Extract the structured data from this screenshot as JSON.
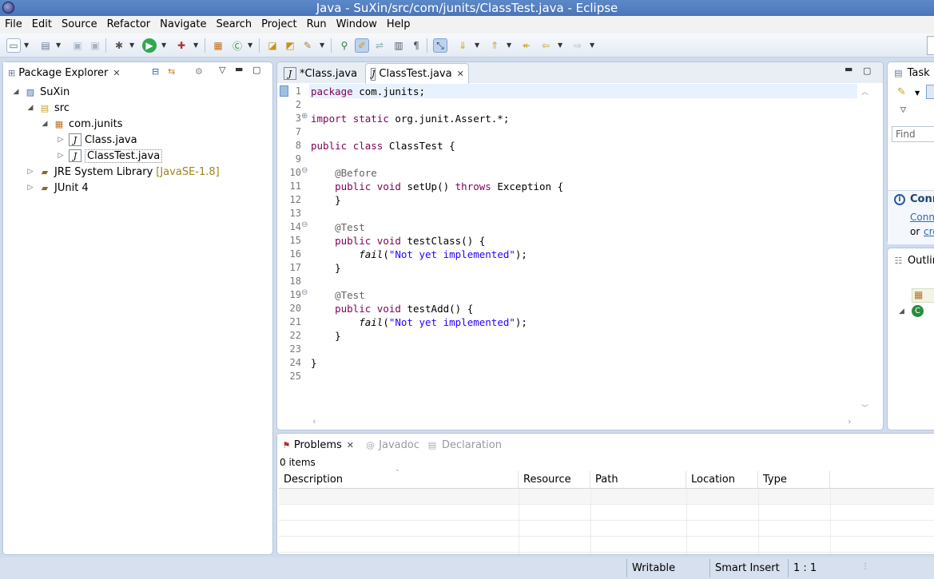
{
  "window": {
    "title": "Java - SuXin/src/com/junits/ClassTest.java - Eclipse"
  },
  "menu": [
    "File",
    "Edit",
    "Source",
    "Refactor",
    "Navigate",
    "Search",
    "Project",
    "Run",
    "Window",
    "Help"
  ],
  "package_explorer": {
    "title": "Package Explorer",
    "tree": {
      "project": "SuXin",
      "src": "src",
      "package": "com.junits",
      "file1": "Class.java",
      "file2": "ClassTest.java",
      "jre": "JRE System Library",
      "jre_version": "[JavaSE-1.8]",
      "junit": "JUnit 4"
    }
  },
  "editor": {
    "tabs": [
      "*Class.java",
      "ClassTest.java"
    ],
    "active_tab": 1,
    "line_numbers": [
      "1",
      "2",
      "3",
      "7",
      "8",
      "9",
      "10",
      "11",
      "12",
      "13",
      "14",
      "15",
      "16",
      "17",
      "18",
      "19",
      "20",
      "21",
      "22",
      "23",
      "24",
      "25"
    ]
  },
  "right_panel": {
    "task_title": "Task L",
    "find_placeholder": "Find",
    "connect_title": "Conn",
    "connect_link": "Conn",
    "connect_or": "or",
    "connect_create": "cre",
    "outline_title": "Outlin"
  },
  "bottom": {
    "tabs": [
      "Problems",
      "Javadoc",
      "Declaration"
    ],
    "items_count": "0 items",
    "columns": [
      "Description",
      "Resource",
      "Path",
      "Location",
      "Type"
    ]
  },
  "status": {
    "writable": "Writable",
    "insert_mode": "Smart Insert",
    "position": "1 : 1"
  },
  "colors": {
    "keyword": "#7f0055",
    "annotation": "#646464",
    "string": "#2a00ff",
    "line_number": "#787878",
    "title_bar": "#4a75b8",
    "workbench_bg": "#cfdcee"
  }
}
